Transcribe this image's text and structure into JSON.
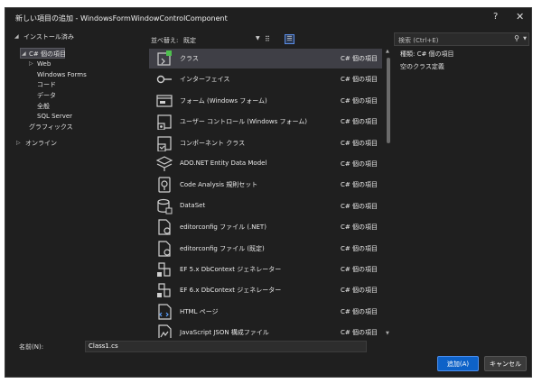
{
  "window": {
    "title": "新しい項目の追加 - WindowsFormWindowControlComponent",
    "help_glyph": "?",
    "close_glyph": "✕"
  },
  "tree": {
    "installed": "インストール済み",
    "csharp_items": "C# 個の項目",
    "web": "Web",
    "windows_forms": "Windows Forms",
    "code": "コード",
    "data": "データ",
    "general": "全般",
    "sql_server": "SQL Server",
    "graphics": "グラフィックス",
    "online": "オンライン"
  },
  "toolbar": {
    "sort_label": "並べ替え:",
    "sort_value": "既定",
    "search_placeholder": "検索 (Ctrl+E)"
  },
  "templates": [
    {
      "name": "クラス",
      "type": "C# 個の項目",
      "icon": "class-icon"
    },
    {
      "name": "インターフェイス",
      "type": "C# 個の項目",
      "icon": "interface-icon"
    },
    {
      "name": "フォーム (Windows フォーム)",
      "type": "C# 個の項目",
      "icon": "form-icon"
    },
    {
      "name": "ユーザー コントロール (Windows フォーム)",
      "type": "C# 個の項目",
      "icon": "user-control-icon"
    },
    {
      "name": "コンポーネント クラス",
      "type": "C# 個の項目",
      "icon": "component-class-icon"
    },
    {
      "name": "ADO.NET Entity Data Model",
      "type": "C# 個の項目",
      "icon": "entity-model-icon"
    },
    {
      "name": "Code Analysis 規則セット",
      "type": "C# 個の項目",
      "icon": "ruleset-icon"
    },
    {
      "name": "DataSet",
      "type": "C# 個の項目",
      "icon": "dataset-icon"
    },
    {
      "name": "editorconfig ファイル (.NET)",
      "type": "C# 個の項目",
      "icon": "config-file-icon"
    },
    {
      "name": "editorconfig ファイル (既定)",
      "type": "C# 個の項目",
      "icon": "config-file-icon"
    },
    {
      "name": "EF 5.x DbContext ジェネレーター",
      "type": "C# 個の項目",
      "icon": "ef-generator-icon"
    },
    {
      "name": "EF 6.x DbContext ジェネレーター",
      "type": "C# 個の項目",
      "icon": "ef-generator-icon"
    },
    {
      "name": "HTML ページ",
      "type": "C# 個の項目",
      "icon": "html-page-icon"
    },
    {
      "name": "JavaScript JSON 構成ファイル",
      "type": "C# 個の項目",
      "icon": "json-config-icon"
    }
  ],
  "details": {
    "type_line": "種類:  C# 個の項目",
    "description": "空のクラス定義"
  },
  "form": {
    "name_label": "名前(N):",
    "name_value": "Class1.cs",
    "add_button": "追加(A)",
    "cancel_button": "キャンセル"
  },
  "colors": {
    "background": "#1f1f1f",
    "selected_row": "#3f3f46",
    "accent_blue": "#0e62c8",
    "icon_green": "#4ec04e"
  }
}
